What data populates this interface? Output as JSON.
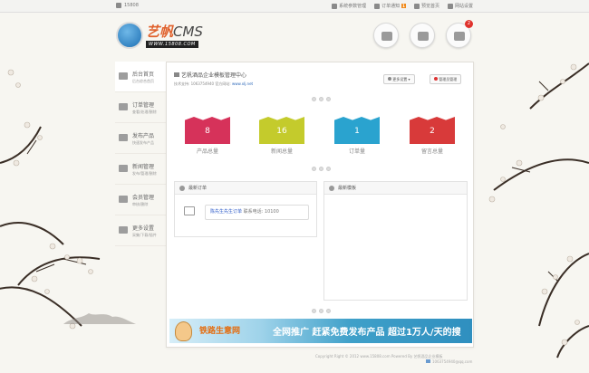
{
  "topbar": {
    "site": "15808",
    "links": [
      {
        "label": "系统参数管理",
        "icon": "document-icon"
      },
      {
        "label": "订单通知",
        "icon": "mail-icon",
        "badge": "1"
      },
      {
        "label": "预览首页",
        "icon": "cloud-icon"
      },
      {
        "label": "网站设置",
        "icon": "sliders-icon"
      }
    ]
  },
  "logo": {
    "name_cn": "艺帆",
    "name_en": "CMS",
    "url": "WWW.15808.COM"
  },
  "actions": {
    "message_badge": "2"
  },
  "sidebar": {
    "items": [
      {
        "title": "后台首页",
        "sub": "后台综合首页",
        "icon": "billboard-icon"
      },
      {
        "title": "订单管理",
        "sub": "查看/处理/删除",
        "icon": "mail-icon"
      },
      {
        "title": "发布产品",
        "sub": "快速发布产品",
        "icon": "edit-icon"
      },
      {
        "title": "新闻管理",
        "sub": "发布/管理/删除",
        "icon": "news-icon"
      },
      {
        "title": "会员管理",
        "sub": "审核/删除",
        "icon": "users-icon"
      },
      {
        "title": "更多设置",
        "sub": "采集/下载/插件",
        "icon": "chart-icon"
      }
    ]
  },
  "header": {
    "title": "艺帆酒品企业模板管理中心",
    "support_prefix": "技术支持: 1063754940 官方网站:",
    "support_url": "www.xlj.net",
    "btn_more": "更多设置",
    "btn_admin": "管理员管理"
  },
  "stats": [
    {
      "value": "8",
      "label": "产品总量",
      "color": "#d6325a"
    },
    {
      "value": "16",
      "label": "新闻总量",
      "color": "#c4cb2c"
    },
    {
      "value": "1",
      "label": "订单量",
      "color": "#2aa3cf"
    },
    {
      "value": "2",
      "label": "留言总量",
      "color": "#d83a3a"
    }
  ],
  "panels": {
    "orders_title": "最新订单",
    "order_name": "陈先生先生订单",
    "order_phone": "联系电话: 10100",
    "template_title": "最新模板"
  },
  "banner": {
    "left": "铁路生意网",
    "right": "全网推广 赶紧免费发布产品 超过1万人/天的搜"
  },
  "footer": {
    "line1": "Copyright Right © 2012 www.15808.com Powered By 艺帆酒品企业模板",
    "line2": "1063754940@qq.com"
  }
}
